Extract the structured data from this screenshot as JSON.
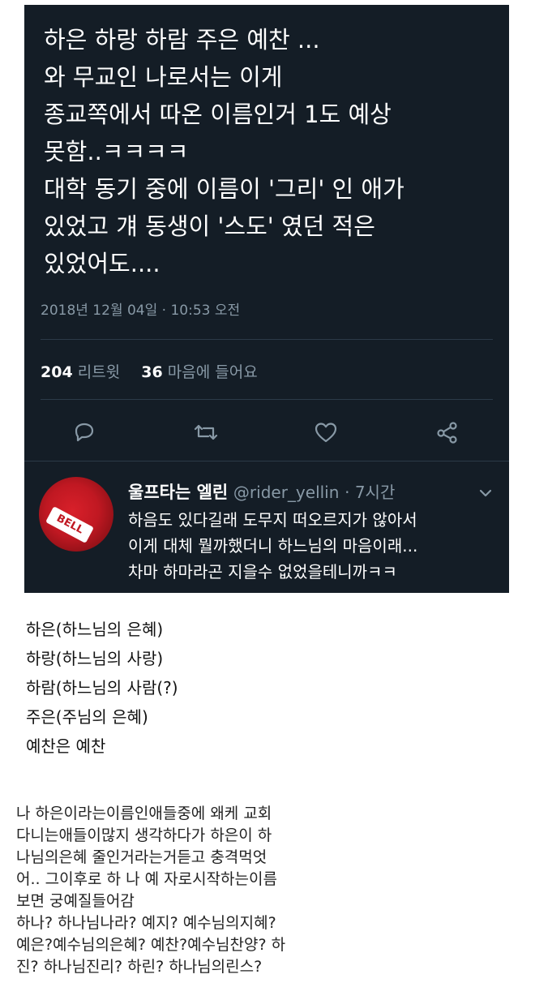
{
  "tweet": {
    "text": "하은 하랑 하람 주은 예찬 ...\n와 무교인 나로서는 이게\n종교쪽에서 따온 이름인거 1도 예상\n못함..ㅋㅋㅋㅋ\n대학 동기 중에 이름이 '그리' 인 애가\n있었고 걔 동생이 '스도' 였던 적은\n있었어도....",
    "timestamp": "2018년 12월 04일 · 10:53 오전",
    "retweet_count": "204",
    "retweet_label": "리트윗",
    "like_count": "36",
    "like_label": "마음에 들어요"
  },
  "reply": {
    "name": "울프타는 엘린",
    "handle": "@rider_yellin",
    "time": "· 7시간",
    "text": "하음도 있다길래 도무지 떠오르지가 않아서\n이게 대체 뭘까했더니 하느님의 마음이래...\n차마 하마라곤 지을수 없었을테니까ㅋㅋ",
    "avatar_logo": "BELL"
  },
  "notes": [
    "하은(하느님의 은혜)",
    "하랑(하느님의 사랑)",
    "하람(하느님의 사람(?)",
    "주은(주님의 은혜)",
    "예찬은 예찬"
  ],
  "comment": "나 하은이라는이름인애들중에 왜케 교회\n다니는애들이많지 생각하다가 하은이 하\n나님의은혜 줄인거라는거듣고 충격먹엇\n어.. 그이후로 하 나 예 자로시작하는이름\n보면 궁예질들어감\n하나? 하나님나라? 예지? 예수님의지혜?\n예은?예수님의은혜? 예찬?예수님찬양? 하\n진? 하나님진리? 하린? 하나님의린스?",
  "colors": {
    "tweet_bg": "#141d26",
    "secondary_text": "#8899a6",
    "icon_color": "#8899a6"
  },
  "icons": [
    "reply-icon",
    "retweet-icon",
    "like-icon",
    "share-icon",
    "chevron-down-icon"
  ]
}
